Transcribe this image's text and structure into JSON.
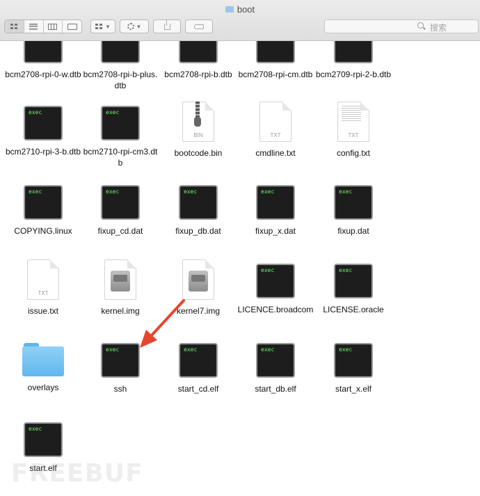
{
  "window": {
    "title": "boot"
  },
  "toolbar": {
    "view_modes": [
      "icon",
      "list",
      "column",
      "cover-flow"
    ],
    "active_view": "icon",
    "search": {
      "placeholder": "搜索"
    }
  },
  "files": [
    {
      "name": "bcm2708-rpi-0-w.dtb",
      "icon": "exec"
    },
    {
      "name": "bcm2708-rpi-b-plus.dtb",
      "icon": "exec"
    },
    {
      "name": "bcm2708-rpi-b.dtb",
      "icon": "exec"
    },
    {
      "name": "bcm2708-rpi-cm.dtb",
      "icon": "exec"
    },
    {
      "name": "bcm2709-rpi-2-b.dtb",
      "icon": "exec"
    },
    {
      "name": "bcm2710-rpi-3-b.dtb",
      "icon": "exec",
      "icon_text": "exec"
    },
    {
      "name": "bcm2710-rpi-cm3.dtb",
      "icon": "exec",
      "icon_text": "exec"
    },
    {
      "name": "bootcode.bin",
      "icon": "bin",
      "icon_text": "BIN"
    },
    {
      "name": "cmdline.txt",
      "icon": "txt",
      "icon_text": "TXT"
    },
    {
      "name": "config.txt",
      "icon": "txt-lines",
      "icon_text": "TXT"
    },
    {
      "name": "COPYING.linux",
      "icon": "exec",
      "icon_text": "exec"
    },
    {
      "name": "fixup_cd.dat",
      "icon": "exec",
      "icon_text": "exec"
    },
    {
      "name": "fixup_db.dat",
      "icon": "exec",
      "icon_text": "exec"
    },
    {
      "name": "fixup_x.dat",
      "icon": "exec",
      "icon_text": "exec"
    },
    {
      "name": "fixup.dat",
      "icon": "exec",
      "icon_text": "exec"
    },
    {
      "name": "issue.txt",
      "icon": "txt",
      "icon_text": "TXT"
    },
    {
      "name": "kernel.img",
      "icon": "disk-image"
    },
    {
      "name": "kernel7.img",
      "icon": "disk-image"
    },
    {
      "name": "LICENCE.broadcom",
      "icon": "exec",
      "icon_text": "exec"
    },
    {
      "name": "LICENSE.oracle",
      "icon": "exec",
      "icon_text": "exec"
    },
    {
      "name": "overlays",
      "icon": "folder"
    },
    {
      "name": "ssh",
      "icon": "exec",
      "icon_text": "exec",
      "highlighted_by_arrow": true
    },
    {
      "name": "start_cd.elf",
      "icon": "exec",
      "icon_text": "exec"
    },
    {
      "name": "start_db.elf",
      "icon": "exec",
      "icon_text": "exec"
    },
    {
      "name": "start_x.elf",
      "icon": "exec",
      "icon_text": "exec"
    },
    {
      "name": "start.elf",
      "icon": "exec",
      "icon_text": "exec"
    }
  ],
  "annotation": {
    "arrow_color": "#e8452c",
    "points_to": "ssh"
  },
  "watermark": "FREEBUF"
}
